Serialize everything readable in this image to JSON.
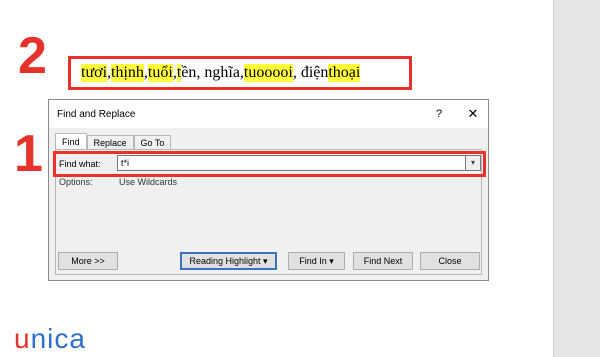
{
  "annotations": {
    "step1": "1",
    "step2": "2"
  },
  "sample": [
    {
      "text": "tươi",
      "hl": true
    },
    {
      "text": ", ",
      "hl": false
    },
    {
      "text": "thịnh",
      "hl": true
    },
    {
      "text": ", ",
      "hl": false
    },
    {
      "text": "tuổi",
      "hl": true
    },
    {
      "text": ", ",
      "hl": false
    },
    {
      "text": "t",
      "hl": true
    },
    {
      "text": "ền, nghĩa, ",
      "hl": false
    },
    {
      "text": "tuooooi",
      "hl": true
    },
    {
      "text": ", điện ",
      "hl": false
    },
    {
      "text": "thoại",
      "hl": true
    }
  ],
  "dialog": {
    "title": "Find and Replace",
    "help": "?",
    "close": "✕",
    "tabs": [
      "Find",
      "Replace",
      "Go To"
    ],
    "find_label": "Find what:",
    "find_value": "t*i",
    "dropdown_icon": "▾",
    "options_label": "Options:",
    "options_value": "Use Wildcards",
    "buttons": {
      "more": "More >>",
      "reading_highlight": "Reading Highlight ▾",
      "find_in": "Find In ▾",
      "find_next": "Find Next",
      "close": "Close"
    }
  },
  "brand": {
    "first": "u",
    "rest": "nica"
  },
  "colors": {
    "annotation_red": "#e5322b",
    "highlight_yellow": "#ffff3b",
    "brand_blue": "#2f6fd0"
  }
}
